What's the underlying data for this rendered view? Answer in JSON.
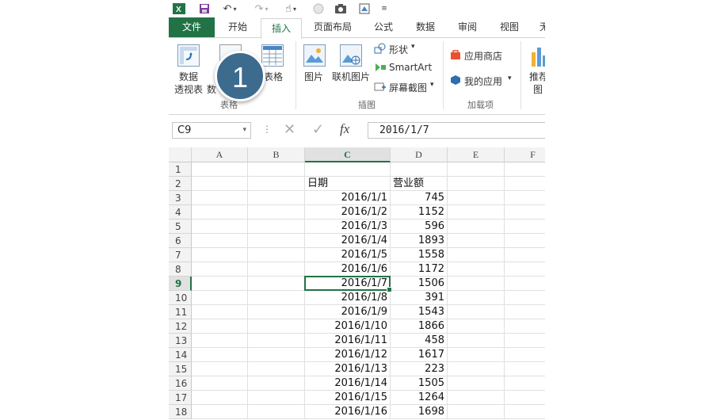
{
  "tabs": [
    "文件",
    "开始",
    "插入",
    "页面布局",
    "公式",
    "数据",
    "审阅",
    "视图",
    "无"
  ],
  "ribbon": {
    "pivot_line1": "数据",
    "pivot_line2": "透视表",
    "recommended_pivot": "数",
    "table": "表格",
    "group_tables": "表格",
    "picture": "图片",
    "online_picture": "联机图片",
    "shapes": "形状",
    "smartart": "SmartArt",
    "screenshot": "屏幕截图",
    "group_illustrations": "插图",
    "app_store": "应用商店",
    "my_apps": "我的应用",
    "group_addins": "加载项",
    "recommended_charts_1": "推荐",
    "recommended_charts_2": "图"
  },
  "callout": "1",
  "formula_bar": {
    "name_box": "C9",
    "fx": "fx",
    "value": "2016/1/7"
  },
  "columns": [
    "A",
    "B",
    "C",
    "D",
    "E",
    "F"
  ],
  "selected_column": "C",
  "selected_row": 9,
  "headers": {
    "date": "日期",
    "sales": "营业额"
  },
  "rows": [
    {
      "n": "1",
      "date": "",
      "sales": ""
    },
    {
      "n": "2",
      "date": "",
      "sales": ""
    },
    {
      "n": "3",
      "date": "2016/1/1",
      "sales": "745"
    },
    {
      "n": "4",
      "date": "2016/1/2",
      "sales": "1152"
    },
    {
      "n": "5",
      "date": "2016/1/3",
      "sales": "596"
    },
    {
      "n": "6",
      "date": "2016/1/4",
      "sales": "1893"
    },
    {
      "n": "7",
      "date": "2016/1/5",
      "sales": "1558"
    },
    {
      "n": "8",
      "date": "2016/1/6",
      "sales": "1172"
    },
    {
      "n": "9",
      "date": "2016/1/7",
      "sales": "1506"
    },
    {
      "n": "10",
      "date": "2016/1/8",
      "sales": "391"
    },
    {
      "n": "11",
      "date": "2016/1/9",
      "sales": "1543"
    },
    {
      "n": "12",
      "date": "2016/1/10",
      "sales": "1866"
    },
    {
      "n": "13",
      "date": "2016/1/11",
      "sales": "458"
    },
    {
      "n": "14",
      "date": "2016/1/12",
      "sales": "1617"
    },
    {
      "n": "15",
      "date": "2016/1/13",
      "sales": "223"
    },
    {
      "n": "16",
      "date": "2016/1/14",
      "sales": "1505"
    },
    {
      "n": "17",
      "date": "2016/1/15",
      "sales": "1264"
    },
    {
      "n": "18",
      "date": "2016/1/16",
      "sales": "1698"
    }
  ],
  "colors": {
    "excel_green": "#217346",
    "callout": "#3d6b8e"
  }
}
